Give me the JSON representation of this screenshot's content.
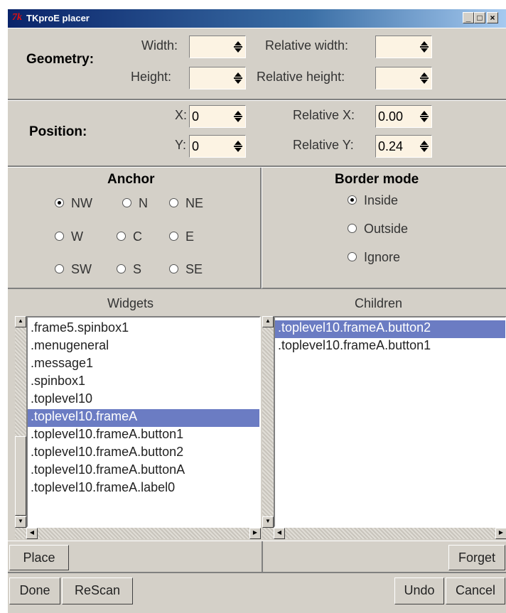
{
  "window": {
    "logo": "7k",
    "title": "TKproE placer",
    "controls": [
      "_",
      "□",
      "×"
    ]
  },
  "geometry": {
    "heading": "Geometry:",
    "width_label": "Width:",
    "width_value": "",
    "height_label": "Height:",
    "height_value": "",
    "rel_width_label": "Relative width:",
    "rel_width_value": "",
    "rel_height_label": "Relative height:",
    "rel_height_value": ""
  },
  "position": {
    "heading": "Position:",
    "x_label": "X:",
    "x_value": "0",
    "y_label": "Y:",
    "y_value": "0",
    "rel_x_label": "Relative X:",
    "rel_x_value": "0.00",
    "rel_y_label": "Relative Y:",
    "rel_y_value": "0.24"
  },
  "anchor": {
    "heading": "Anchor",
    "options": [
      "NW",
      "N",
      "NE",
      "W",
      "C",
      "E",
      "SW",
      "S",
      "SE"
    ],
    "selected": "NW"
  },
  "border_mode": {
    "heading": "Border mode",
    "options": [
      "Inside",
      "Outside",
      "Ignore"
    ],
    "selected": "Inside"
  },
  "widgets": {
    "heading": "Widgets",
    "items": [
      ".frame5.spinbox1",
      ".menugeneral",
      ".message1",
      ".spinbox1",
      ".toplevel10",
      ".toplevel10.frameA",
      ".toplevel10.frameA.button1",
      ".toplevel10.frameA.button2",
      ".toplevel10.frameA.buttonA",
      ".toplevel10.frameA.label0"
    ],
    "selected_index": 5
  },
  "children": {
    "heading": "Children",
    "items": [
      ".toplevel10.frameA.button2",
      ".toplevel10.frameA.button1"
    ],
    "selected_index": 0
  },
  "buttons": {
    "place": "Place",
    "forget": "Forget",
    "done": "Done",
    "rescan": "ReScan",
    "undo": "Undo",
    "cancel": "Cancel"
  }
}
